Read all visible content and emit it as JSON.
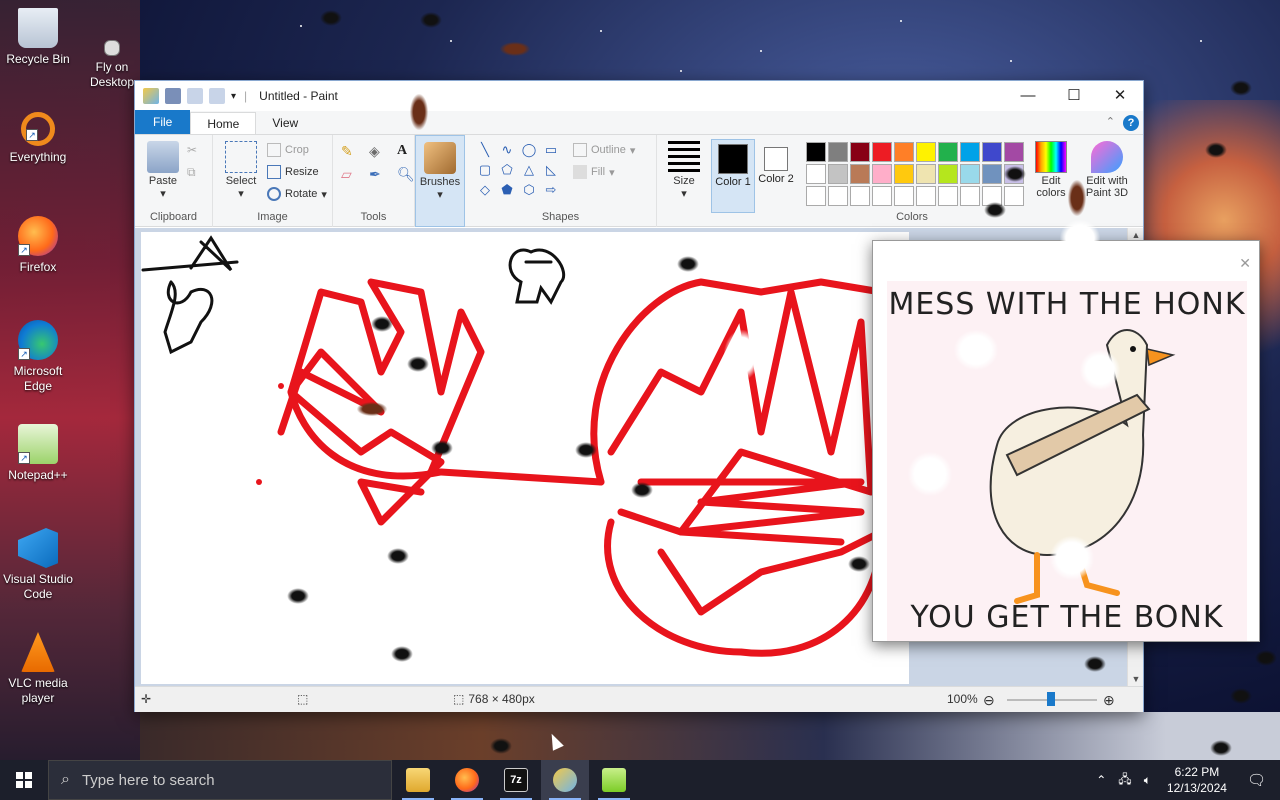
{
  "desktop": {
    "icons": [
      {
        "label": "Recycle Bin",
        "icon": "recycle-bin-icon"
      },
      {
        "label": "Fly on Desktop",
        "icon": "fly-shortcut-icon"
      },
      {
        "label": "Everything",
        "icon": "everything-search-icon"
      },
      {
        "label": "Firefox",
        "icon": "firefox-icon"
      },
      {
        "label": "Microsoft Edge",
        "icon": "edge-icon"
      },
      {
        "label": "Notepad++",
        "icon": "notepadpp-icon"
      },
      {
        "label": "Visual Studio Code",
        "icon": "vscode-icon"
      },
      {
        "label": "VLC media player",
        "icon": "vlc-icon"
      }
    ]
  },
  "paint": {
    "title": "Untitled - Paint",
    "tabs": {
      "file": "File",
      "home": "Home",
      "view": "View"
    },
    "clipboard": {
      "paste": "Paste",
      "group": "Clipboard"
    },
    "image": {
      "select": "Select",
      "crop": "Crop",
      "resize": "Resize",
      "rotate": "Rotate",
      "group": "Image"
    },
    "tools": {
      "group": "Tools"
    },
    "brushes": "Brushes",
    "shapes": {
      "outline": "Outline",
      "fill": "Fill",
      "group": "Shapes"
    },
    "size": "Size",
    "color1": "Color 1",
    "color2": "Color 2",
    "colors_group": "Colors",
    "edit_colors": "Edit colors",
    "paint3d": "Edit with Paint 3D",
    "status": {
      "dimensions": "768 × 480px",
      "zoom": "100%"
    },
    "palette": [
      "#000000",
      "#7f7f7f",
      "#880015",
      "#ed1c24",
      "#ff7f27",
      "#fff200",
      "#22b14c",
      "#00a2e8",
      "#3f48cc",
      "#a349a4",
      "#ffffff",
      "#c3c3c3",
      "#b97a57",
      "#ffaec9",
      "#ffc90e",
      "#efe4b0",
      "#b5e61d",
      "#99d9ea",
      "#7092be",
      "#c8bfe7"
    ]
  },
  "popup": {
    "top_text": "MESS WITH THE HONK",
    "bottom_text": "YOU GET THE BONK"
  },
  "taskbar": {
    "search_placeholder": "Type here to search",
    "time": "6:22 PM",
    "date": "12/13/2024"
  }
}
